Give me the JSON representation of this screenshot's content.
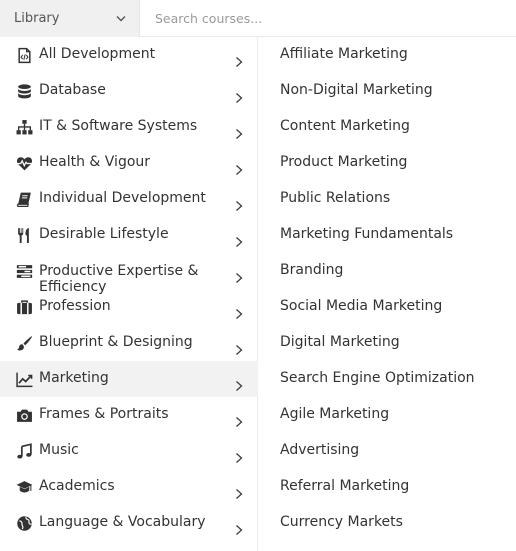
{
  "header": {
    "library_label": "Library",
    "search_placeholder": "Search courses..."
  },
  "categories": [
    {
      "label": "All Development",
      "icon": "code-file-icon"
    },
    {
      "label": "Database",
      "icon": "database-icon"
    },
    {
      "label": "IT & Software Systems",
      "icon": "sitemap-icon"
    },
    {
      "label": "Health & Vigour",
      "icon": "heartbeat-icon"
    },
    {
      "label": "Individual Development",
      "icon": "book-icon"
    },
    {
      "label": "Desirable Lifestyle",
      "icon": "cutlery-icon"
    },
    {
      "label": "Productive Expertise & Efficiency",
      "icon": "tasks-icon"
    },
    {
      "label": "Profession",
      "icon": "briefcase-icon"
    },
    {
      "label": "Blueprint & Designing",
      "icon": "paint-brush-icon"
    },
    {
      "label": "Marketing",
      "icon": "line-chart-icon",
      "active": true
    },
    {
      "label": "Frames & Portraits",
      "icon": "camera-icon"
    },
    {
      "label": "Music",
      "icon": "music-icon"
    },
    {
      "label": "Academics",
      "icon": "graduation-cap-icon"
    },
    {
      "label": "Language & Vocabulary",
      "icon": "globe-icon"
    }
  ],
  "subcategories": [
    "Affiliate Marketing",
    "Non-Digital Marketing",
    "Content Marketing",
    "Product Marketing",
    "Public Relations",
    "Marketing Fundamentals",
    "Branding",
    "Social Media Marketing",
    "Digital Marketing",
    "Search Engine Optimization",
    "Agile Marketing",
    "Advertising",
    "Referral Marketing",
    "Currency Markets"
  ]
}
